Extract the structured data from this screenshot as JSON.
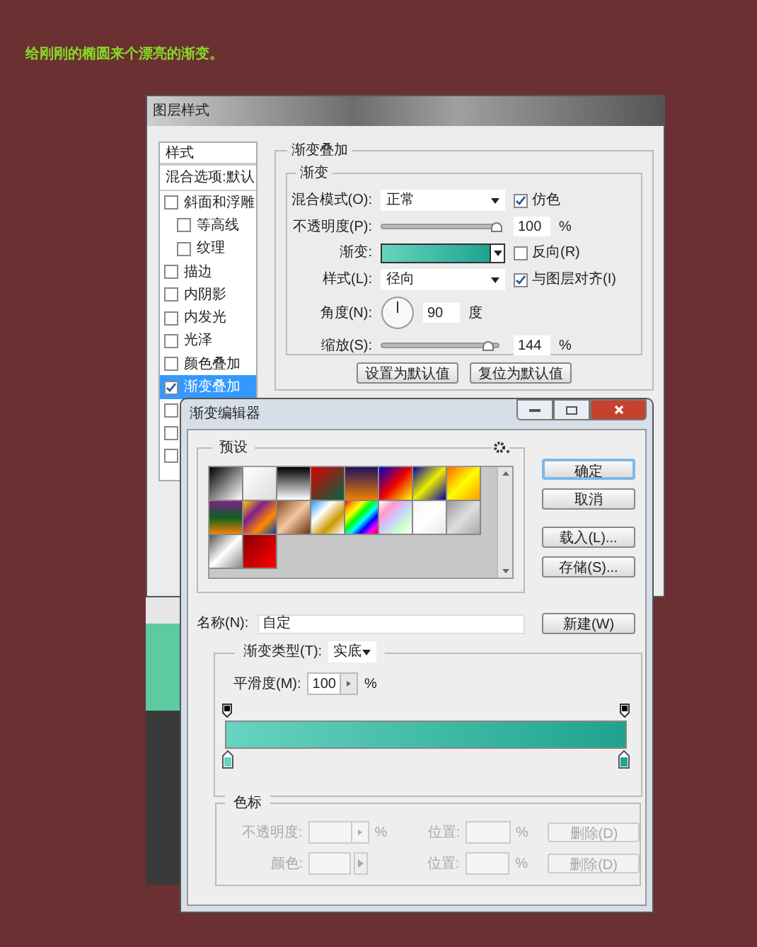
{
  "caption": "给刚刚的椭圆来个漂亮的渐变。",
  "layer_style": {
    "title": "图层样式",
    "styles_header": "样式",
    "blending_options": "混合选项:默认",
    "effects": [
      {
        "label": "斜面和浮雕",
        "checked": false,
        "selected": false,
        "children": [
          {
            "label": "等高线",
            "checked": false,
            "selected": false
          },
          {
            "label": "纹理",
            "checked": false,
            "selected": false
          }
        ]
      },
      {
        "label": "描边",
        "checked": false,
        "selected": false
      },
      {
        "label": "内阴影",
        "checked": false,
        "selected": false
      },
      {
        "label": "内发光",
        "checked": false,
        "selected": false
      },
      {
        "label": "光泽",
        "checked": false,
        "selected": false
      },
      {
        "label": "颜色叠加",
        "checked": false,
        "selected": false
      },
      {
        "label": "渐变叠加",
        "checked": true,
        "selected": true
      }
    ],
    "hidden_effects": [
      {
        "checked": false
      },
      {
        "checked": false
      },
      {
        "checked": false
      }
    ],
    "panel_title": "渐变叠加",
    "group_title": "渐变",
    "blend_mode": {
      "label": "混合模式(O):",
      "value": "正常"
    },
    "dither": {
      "label": "仿色",
      "checked": true
    },
    "opacity": {
      "label": "不透明度(P):",
      "level": 1,
      "value": "100",
      "unit": "%"
    },
    "gradient": {
      "label": "渐变:"
    },
    "reverse": {
      "label": "反向(R)",
      "checked": false
    },
    "style": {
      "label": "样式(L):",
      "value": "径向"
    },
    "align": {
      "label": "与图层对齐(I)",
      "checked": true
    },
    "angle": {
      "label": "角度(N):",
      "value": "90",
      "unit": "度"
    },
    "scale": {
      "label": "缩放(S):",
      "level": 0.93,
      "value": "144",
      "unit": "%"
    },
    "buttons": [
      "设置为默认值",
      "复位为默认值"
    ]
  },
  "gradient_editor": {
    "title": "渐变编辑器",
    "presets_title": "预设",
    "buttons": [
      {
        "label": "确定",
        "default": true
      },
      {
        "label": "取消",
        "default": false
      },
      {
        "label": "载入(L)...",
        "default": false
      },
      {
        "label": "存储(S)...",
        "default": false
      }
    ],
    "name_label": "名称(N):",
    "name_value": "自定",
    "new_button": "新建(W)",
    "type_label": "渐变类型(T):",
    "type_value": "实底",
    "smoothness_label": "平滑度(M):",
    "smoothness_value": "100",
    "smoothness_unit": "%",
    "color_stops": [
      {
        "color": "#66d4c0"
      },
      {
        "color": "#1fa38e"
      }
    ],
    "stops_title": "色标",
    "stop_fields": [
      {
        "kind": "stepper",
        "label": "不透明度:",
        "unit": "%",
        "position_label": "位置:",
        "position_unit": "%",
        "delete": "删除(D)",
        "disabled": true
      },
      {
        "kind": "swatch",
        "label": "颜色:",
        "position_label": "位置:",
        "position_unit": "%",
        "delete": "删除(D)",
        "disabled": true
      }
    ]
  }
}
